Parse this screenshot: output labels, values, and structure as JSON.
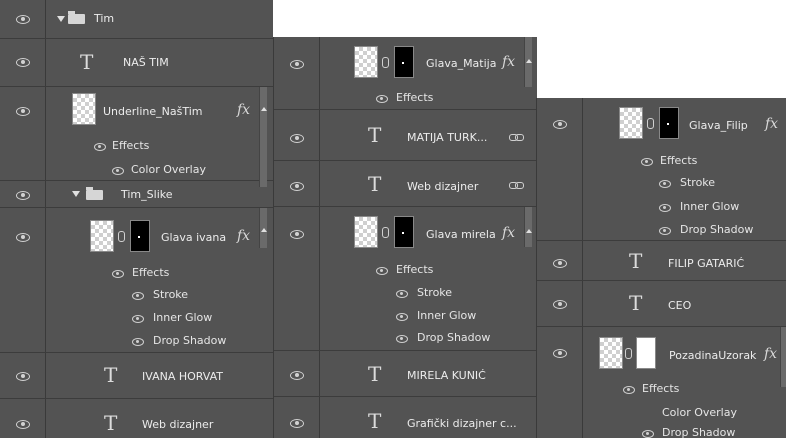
{
  "panel1": {
    "group_tim": "Tim",
    "nas_tim": "NAŠ TIM",
    "underline_name": "Underline_NašTim",
    "underline_effects": "Effects",
    "underline_color_overlay": "Color Overlay",
    "group_tim_slike": "Tim_Slike",
    "glava_ivana": "Glava ivana",
    "ivana_effects": "Effects",
    "ivana_stroke": "Stroke",
    "ivana_inner_glow": "Inner Glow",
    "ivana_drop_shadow": "Drop Shadow",
    "ivana_horvat": "IVANA HORVAT",
    "web_dizajner": "Web dizajner"
  },
  "panel2": {
    "glava_matija": "Glava_Matija",
    "matija_effects": "Effects",
    "matija_turk": "MATIJA TURK...",
    "web_dizajner": "Web dizajner",
    "glava_mirela": "Glava mirela",
    "mirela_effects": "Effects",
    "mirela_stroke": "Stroke",
    "mirela_inner_glow": "Inner Glow",
    "mirela_drop_shadow": "Drop Shadow",
    "mirela_kunic": "MIRELA KUNIĆ",
    "graficki": "Grafički dizajner c..."
  },
  "panel3": {
    "glava_filip": "Glava_Filip",
    "filip_effects": "Effects",
    "filip_stroke": "Stroke",
    "filip_inner_glow": "Inner Glow",
    "filip_drop_shadow": "Drop Shadow",
    "filip_gataric": "FILIP GATARIĆ",
    "ceo": "CEO",
    "pozadina": "PozadinaUzorak",
    "pozadina_effects": "Effects",
    "pozadina_color_overlay": "Color Overlay",
    "pozadina_drop_shadow": "Drop Shadow"
  },
  "icons": {
    "text_layer": "T",
    "fx": "fx"
  },
  "colors": {
    "panel_bg": "#535353",
    "divider": "#3c3c3c",
    "text": "#ececec"
  }
}
